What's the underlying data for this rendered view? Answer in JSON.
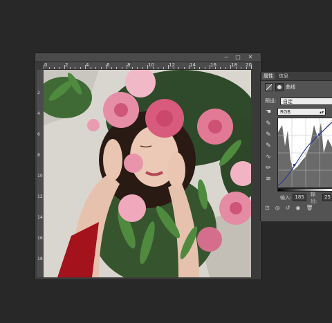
{
  "document": {
    "window_buttons": [
      "−",
      "□",
      "✕"
    ],
    "ruler_numbers": [
      "0",
      "2",
      "4",
      "6",
      "8",
      "10",
      "12",
      "14",
      "16",
      "18",
      "20"
    ],
    "ruler_v_numbers": [
      "2",
      "4",
      "6",
      "8",
      "10",
      "12",
      "14",
      "16",
      "18"
    ],
    "image": "woman-with-peony-flowers-photo"
  },
  "properties": {
    "tabs": [
      "属性",
      "信息"
    ],
    "adjustment_title": "曲线",
    "preset_label": "预设:",
    "preset_value": "自定",
    "channel_value": "RGB",
    "input_label": "输入:",
    "input_value": "185",
    "output_label": "输出:",
    "output_value": "25"
  },
  "colors": {
    "app_bg": "#282828",
    "panel_bg": "#535353",
    "curve": "#2f3a8a"
  }
}
